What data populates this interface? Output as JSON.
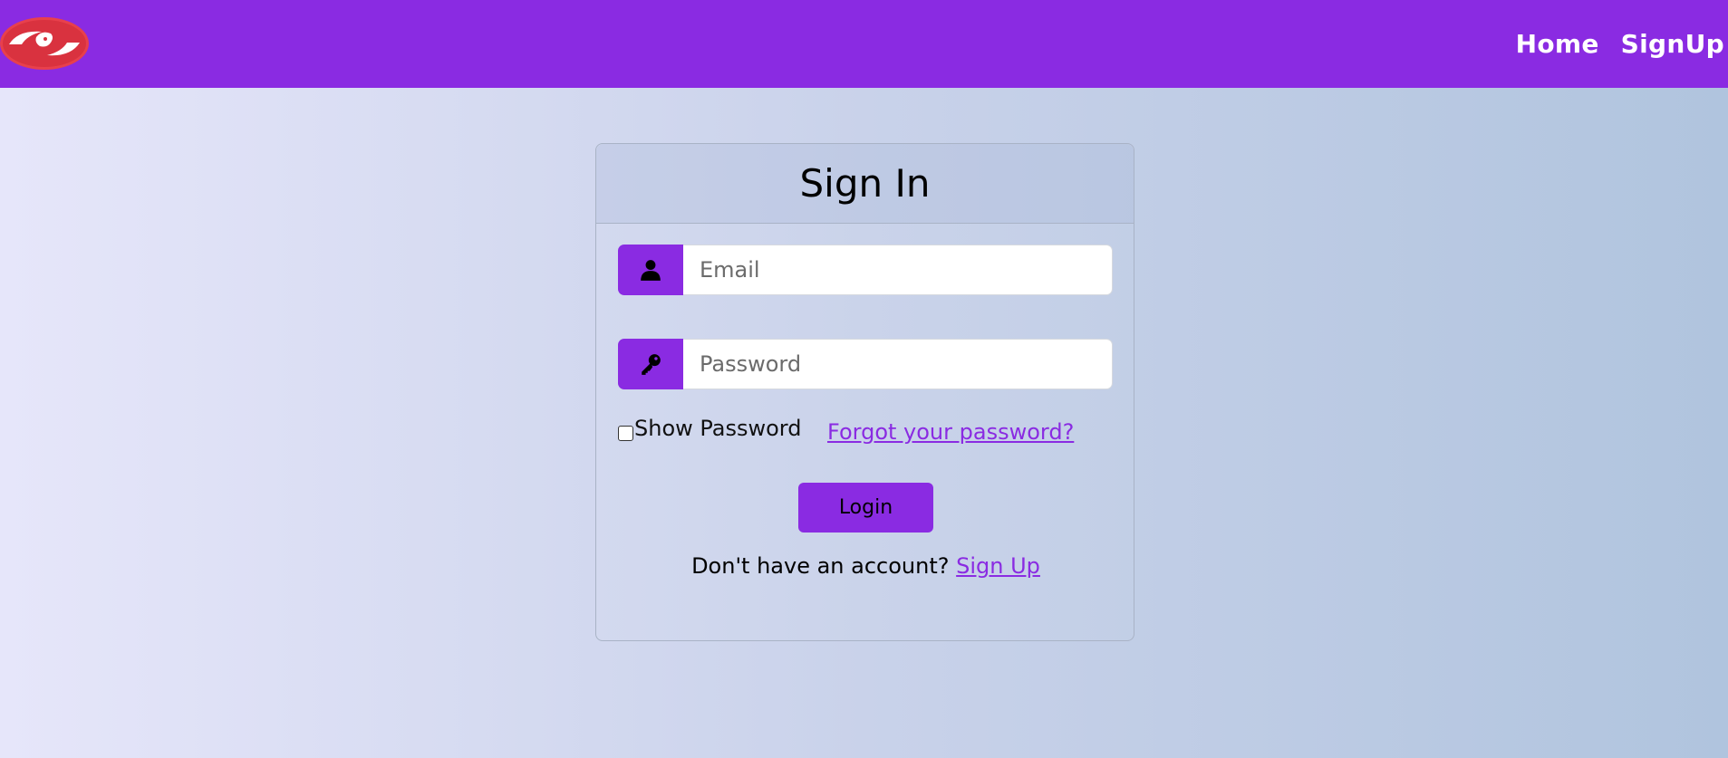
{
  "nav": {
    "logo_icon": "lion-hands-logo",
    "brand_color": "#8a2be2",
    "links": [
      "Home",
      "SignUp"
    ]
  },
  "card": {
    "title": "Sign In",
    "email": {
      "placeholder": "Email",
      "icon": "user-icon"
    },
    "password": {
      "placeholder": "Password",
      "icon": "key-icon"
    },
    "show_password_label": "Show Password",
    "show_password_checked": false,
    "forgot_link": "Forgot your password?",
    "login_button": "Login",
    "signup_prompt": "Don't have an account?",
    "signup_link": "Sign Up"
  }
}
